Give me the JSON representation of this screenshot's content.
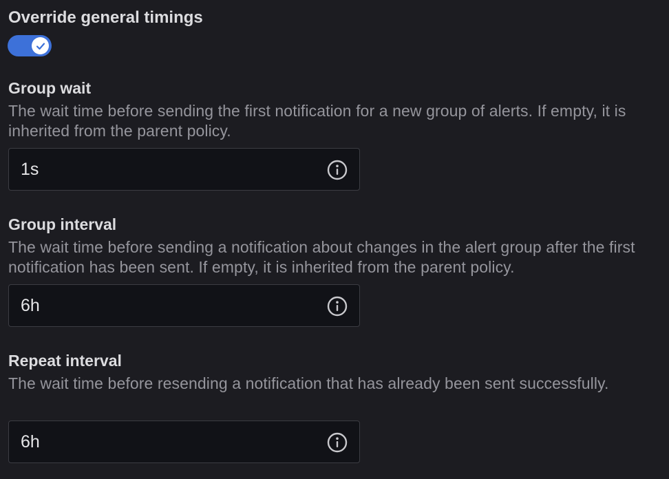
{
  "override_toggle": {
    "label": "Override general timings",
    "checked": true
  },
  "fields": [
    {
      "label": "Group wait",
      "description": "The wait time before sending the first notification for a new group of alerts. If empty, it is inherited from the parent policy.",
      "value": "1s",
      "icon": "info-icon"
    },
    {
      "label": "Group interval",
      "description": "The wait time before sending a notification about changes in the alert group after the first notification has been sent. If empty, it is inherited from the parent policy.",
      "value": "6h",
      "icon": "info-icon"
    },
    {
      "label": "Repeat interval",
      "description": "The wait time before resending a notification that has already been sent successfully.",
      "value": "6h",
      "icon": "info-icon"
    }
  ],
  "colors": {
    "background": "#1c1c21",
    "toggle_on": "#3d71d9",
    "input_bg": "#111217",
    "input_border": "#3c3d43",
    "label_text": "#dcdcdf",
    "description_text": "#95959c"
  }
}
